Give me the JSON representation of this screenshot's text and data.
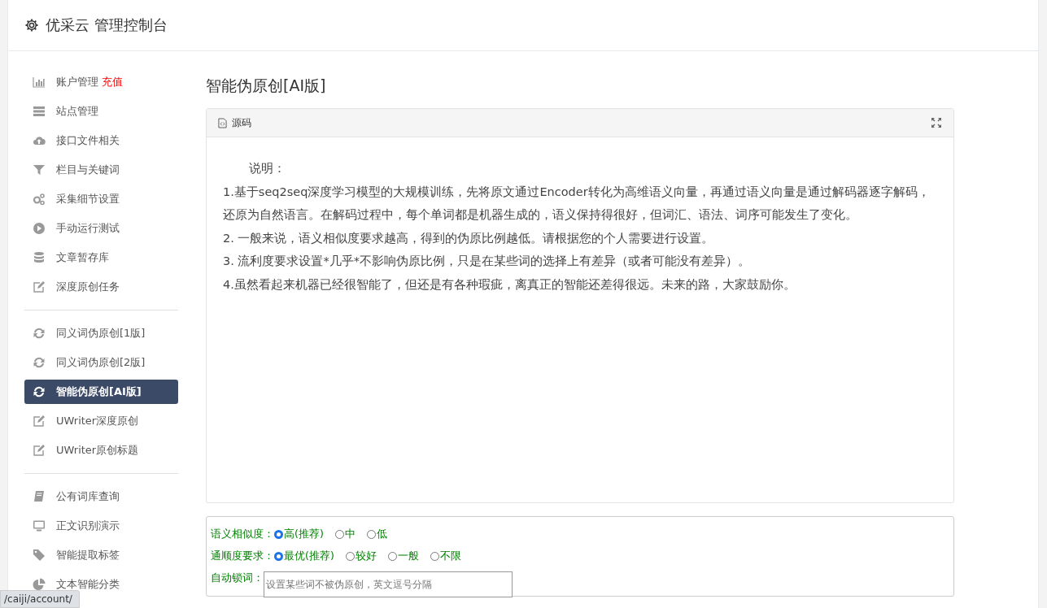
{
  "header": {
    "title": "优采云 管理控制台"
  },
  "sidebar": {
    "groups": [
      {
        "items": [
          {
            "kind": "bar-chart",
            "label": "账户管理",
            "badge": "充值",
            "selected": false
          },
          {
            "kind": "server",
            "label": "站点管理",
            "selected": false
          },
          {
            "kind": "cloud",
            "label": "接口文件相关",
            "selected": false
          },
          {
            "kind": "filter",
            "label": "栏目与关键词",
            "selected": false
          },
          {
            "kind": "gears",
            "label": "采集细节设置",
            "selected": false
          },
          {
            "kind": "play",
            "label": "手动运行测试",
            "selected": false
          },
          {
            "kind": "database",
            "label": "文章暂存库",
            "selected": false
          },
          {
            "kind": "edit",
            "label": "深度原创任务",
            "selected": false
          }
        ]
      },
      {
        "items": [
          {
            "kind": "refresh",
            "label": "同义词伪原创[1版]",
            "selected": false
          },
          {
            "kind": "refresh",
            "label": "同义词伪原创[2版]",
            "selected": false
          },
          {
            "kind": "refresh",
            "label": "智能伪原创[AI版]",
            "selected": true
          },
          {
            "kind": "edit",
            "label": "UWriter深度原创",
            "selected": false
          },
          {
            "kind": "edit",
            "label": "UWriter原创标题",
            "selected": false
          }
        ]
      },
      {
        "items": [
          {
            "kind": "book",
            "label": "公有词库查询",
            "selected": false
          },
          {
            "kind": "monitor",
            "label": "正文识别演示",
            "selected": false
          },
          {
            "kind": "tag",
            "label": "智能提取标签",
            "selected": false
          },
          {
            "kind": "pie",
            "label": "文本智能分类",
            "selected": false
          }
        ]
      }
    ]
  },
  "main": {
    "title": "智能伪原创[AI版]",
    "panel": {
      "tab": "源码",
      "lines": [
        "说明：",
        "1.基于seq2seq深度学习模型的大规模训练，先将原文通过Encoder转化为高维语义向量，再通过语义向量是通过解码器逐字解码，还原为自然语言。在解码过程中，每个单词都是机器生成的，语义保持得很好，但词汇、语法、词序可能发生了变化。",
        "2. 一般来说，语义相似度要求越高，得到的伪原比例越低。请根据您的个人需要进行设置。",
        "3. 流利度要求设置*几乎*不影响伪原比例，只是在某些词的选择上有差异（或者可能没有差异）。",
        "4.虽然看起来机器已经很智能了，但还是有各种瑕疵，离真正的智能还差得很远。未来的路，大家鼓励你。"
      ]
    },
    "form": {
      "radio_groups": [
        {
          "label": "语义相似度：",
          "options": [
            {
              "label": "高(推荐)",
              "selected": true
            },
            {
              "label": "中",
              "selected": false
            },
            {
              "label": "低",
              "selected": false
            }
          ]
        },
        {
          "label": "通顺度要求：",
          "options": [
            {
              "label": "最优(推荐)",
              "selected": true
            },
            {
              "label": "较好",
              "selected": false
            },
            {
              "label": "一般",
              "selected": false
            },
            {
              "label": "不限",
              "selected": false
            }
          ]
        }
      ],
      "lock_words": {
        "label": "自动锁词：",
        "placeholder": "设置某些词不被伪原创，英文逗号分隔"
      }
    }
  },
  "status_bar": {
    "url": "/caiji/account/"
  }
}
